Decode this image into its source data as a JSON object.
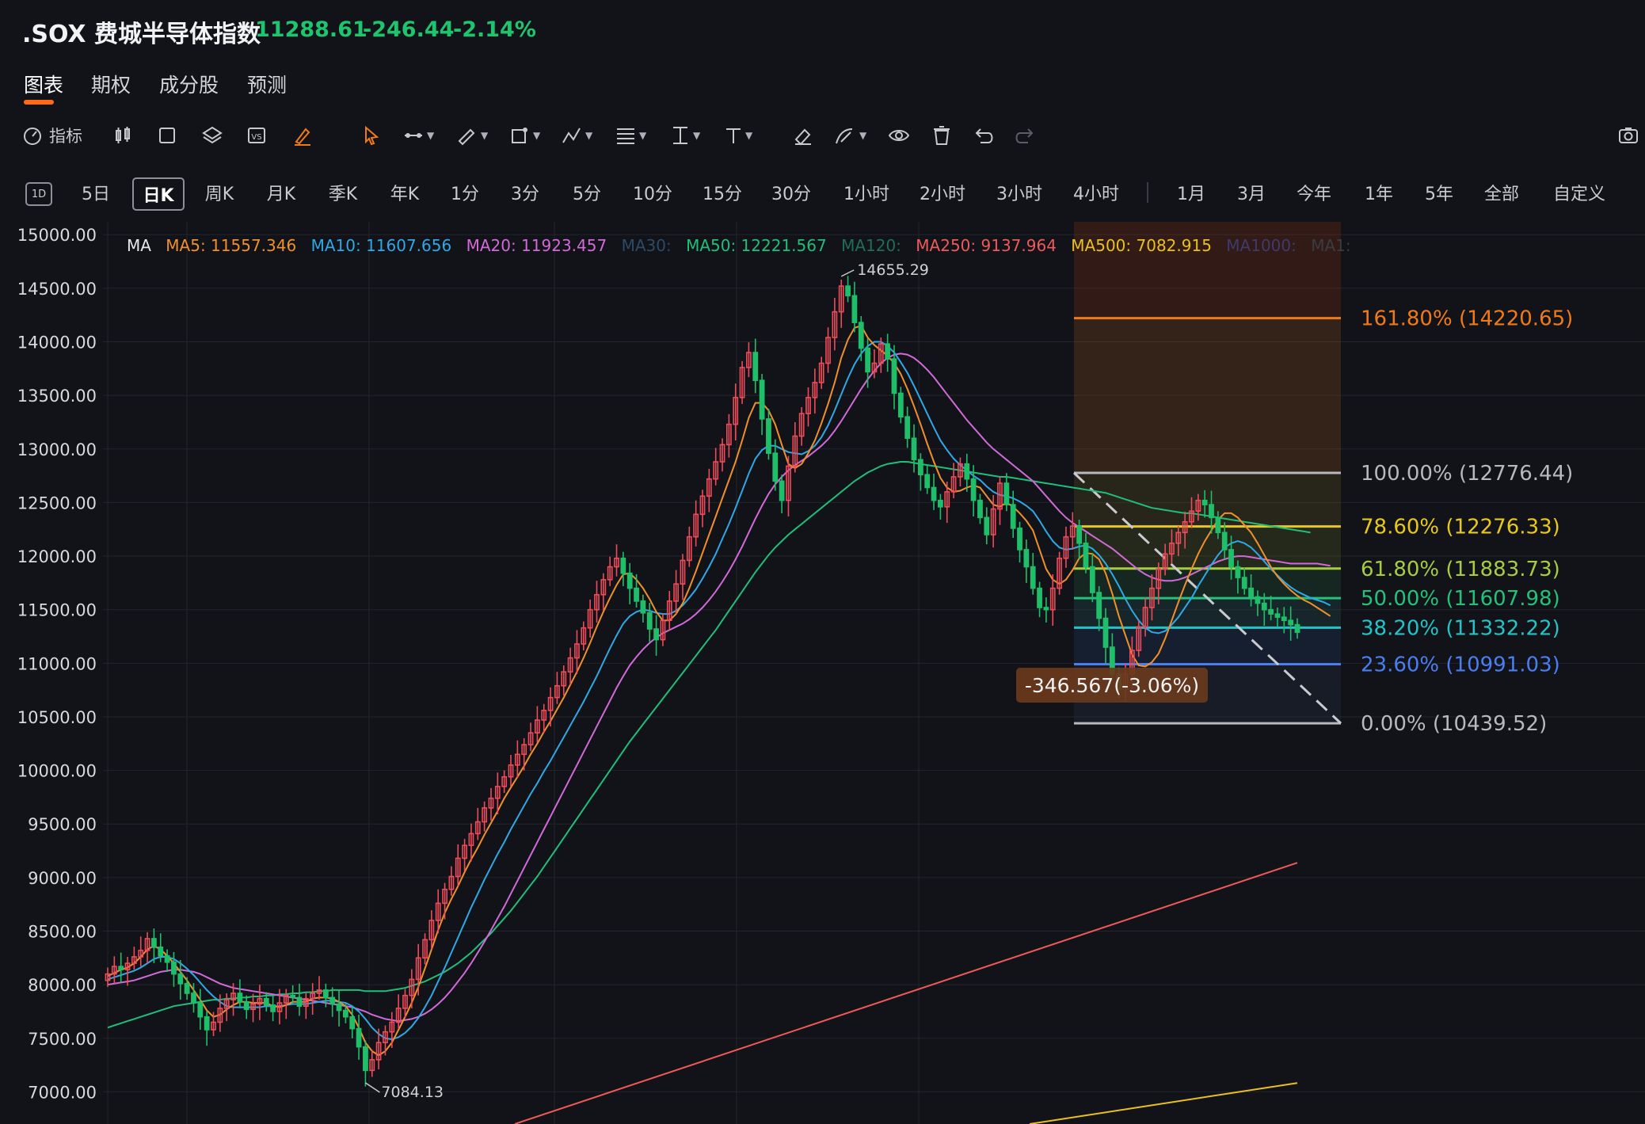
{
  "header": {
    "symbol": ".SOX 费城半导体指数",
    "price": "11288.61",
    "change": "-246.44",
    "change_pct": "-2.14%"
  },
  "tabs": [
    "图表",
    "期权",
    "成分股",
    "预测"
  ],
  "toolbar": {
    "indicator_label": "指标",
    "tools": [
      "candle-style-icon",
      "rectangle-icon",
      "layers-icon",
      "compare-icon",
      "brush-icon",
      "cursor-icon",
      "line-icon",
      "pen-icon",
      "shape-icon",
      "pattern-icon",
      "fibonacci-icon",
      "measure-icon",
      "text-icon",
      "eraser-icon",
      "draw-icon",
      "eye-icon",
      "trash-icon",
      "undo-icon",
      "redo-icon",
      "screenshot-icon"
    ]
  },
  "periods": {
    "day_badge": "1D",
    "items": [
      "5日",
      "日K",
      "周K",
      "月K",
      "季K",
      "年K",
      "1分",
      "3分",
      "5分",
      "10分",
      "15分",
      "30分",
      "1小时",
      "2小时",
      "3小时",
      "4小时",
      "1月",
      "3月",
      "今年",
      "1年",
      "5年",
      "全部",
      "自定义"
    ],
    "active": "日K"
  },
  "ma_legend": {
    "label": "MA",
    "items": [
      {
        "text": "MA5: 11557.346",
        "color": "#f0902a"
      },
      {
        "text": "MA10: 11607.656",
        "color": "#2ea8e6"
      },
      {
        "text": "MA20: 11923.457",
        "color": "#d16ad8"
      },
      {
        "text": "MA30:",
        "color": "#2c4a66"
      },
      {
        "text": "MA50: 12221.567",
        "color": "#1fbf7a"
      },
      {
        "text": "MA120:",
        "color": "#1f6e5a"
      },
      {
        "text": "MA250: 9137.964",
        "color": "#ee5a5a"
      },
      {
        "text": "MA500: 7082.915",
        "color": "#e8c020"
      },
      {
        "text": "MA1000:",
        "color": "#3e3a6a"
      },
      {
        "text": "MA1:",
        "color": "#3a3c44"
      }
    ]
  },
  "chart_data": {
    "type": "candlestick",
    "y_ticks": [
      "15000.00",
      "14500.00",
      "14000.00",
      "13500.00",
      "13000.00",
      "12500.00",
      "12000.00",
      "11500.00",
      "11000.00",
      "10500.00",
      "10000.00",
      "9500.00",
      "9000.00",
      "8500.00",
      "8000.00",
      "7500.00",
      "7000.00"
    ],
    "ylim": [
      6700,
      15120
    ],
    "high_label": "14655.29",
    "high_value": 14655.29,
    "low_label": "7084.13",
    "low_value": 7084.13,
    "measure_label": "-346.567(-3.06%)",
    "colors": {
      "up": "#ef4b5a",
      "down": "#1fbf6a",
      "grid": "#23252c"
    },
    "fibonacci": [
      {
        "label": "161.80% (14220.65)",
        "value": 14220.65,
        "color": "#f07a1a"
      },
      {
        "label": "100.00% (12776.44)",
        "value": 12776.44,
        "color": "#b7b9be"
      },
      {
        "label": "78.60% (12276.33)",
        "value": 12276.33,
        "color": "#e8c81a"
      },
      {
        "label": "61.80% (11883.73)",
        "value": 11883.73,
        "color": "#a6cc45"
      },
      {
        "label": "50.00% (11607.98)",
        "value": 11607.98,
        "color": "#22c27a"
      },
      {
        "label": "38.20% (11332.22)",
        "value": 11332.22,
        "color": "#22c4c8"
      },
      {
        "label": "23.60% (10991.03)",
        "value": 10991.03,
        "color": "#4a7ef0"
      },
      {
        "label": "0.00% (10439.52)",
        "value": 10439.52,
        "color": "#b7b9be"
      }
    ],
    "close": [
      8100,
      8170,
      8140,
      8200,
      8260,
      8320,
      8430,
      8350,
      8270,
      8210,
      8100,
      8010,
      7920,
      7830,
      7700,
      7580,
      7650,
      7780,
      7860,
      7920,
      7840,
      7770,
      7820,
      7870,
      7810,
      7750,
      7830,
      7900,
      7880,
      7800,
      7870,
      7920,
      7950,
      7880,
      7820,
      7760,
      7700,
      7590,
      7420,
      7200,
      7300,
      7460,
      7560,
      7650,
      7780,
      7900,
      8050,
      8250,
      8420,
      8600,
      8760,
      8890,
      9010,
      9180,
      9300,
      9410,
      9520,
      9650,
      9740,
      9850,
      9940,
      10050,
      10150,
      10240,
      10350,
      10470,
      10560,
      10680,
      10790,
      10920,
      11050,
      11180,
      11330,
      11500,
      11640,
      11780,
      11900,
      11980,
      11840,
      11700,
      11580,
      11470,
      11320,
      11220,
      11400,
      11580,
      11740,
      11960,
      12180,
      12390,
      12560,
      12720,
      12880,
      13040,
      13230,
      13480,
      13760,
      13900,
      13640,
      13280,
      12960,
      12700,
      12520,
      12840,
      13120,
      13330,
      13480,
      13620,
      13800,
      14040,
      14280,
      14520,
      14430,
      14180,
      13940,
      13720,
      13800,
      13980,
      13840,
      13520,
      13300,
      13100,
      12900,
      12760,
      12640,
      12520,
      12460,
      12600,
      12740,
      12860,
      12720,
      12520,
      12360,
      12200,
      12440,
      12680,
      12480,
      12260,
      12060,
      11900,
      11700,
      11520,
      11500,
      11700,
      11980,
      12180,
      12280,
      12120,
      11900,
      11660,
      11420,
      11150,
      10900,
      10760,
      10900,
      11120,
      11340,
      11520,
      11700,
      11880,
      12020,
      12120,
      12220,
      12320,
      12420,
      12520,
      12480,
      12360,
      12220,
      12060,
      11900,
      11800,
      11700,
      11620,
      11560,
      11500,
      11460,
      11430,
      11400,
      11360,
      11289
    ],
    "ma5": [
      8080,
      8110,
      8140,
      8160,
      8200,
      8260,
      8330,
      8360,
      8330,
      8270,
      8200,
      8120,
      8040,
      7950,
      7860,
      7760,
      7700,
      7720,
      7770,
      7810,
      7840,
      7840,
      7830,
      7830,
      7830,
      7800,
      7790,
      7810,
      7840,
      7840,
      7840,
      7870,
      7880,
      7880,
      7870,
      7840,
      7800,
      7720,
      7600,
      7460,
      7380,
      7340,
      7380,
      7460,
      7580,
      7700,
      7830,
      7980,
      8150,
      8330,
      8510,
      8670,
      8800,
      8920,
      9050,
      9170,
      9280,
      9400,
      9510,
      9620,
      9740,
      9840,
      9940,
      10040,
      10150,
      10250,
      10360,
      10460,
      10570,
      10680,
      10800,
      10920,
      11050,
      11190,
      11340,
      11480,
      11610,
      11730,
      11830,
      11840,
      11780,
      11700,
      11600,
      11480,
      11400,
      11400,
      11460,
      11560,
      11700,
      11860,
      12030,
      12200,
      12370,
      12540,
      12710,
      12880,
      13080,
      13290,
      13430,
      13430,
      13360,
      13230,
      13040,
      12860,
      12820,
      12860,
      12960,
      13080,
      13240,
      13420,
      13620,
      13850,
      14020,
      14130,
      14150,
      14040,
      13970,
      13920,
      13870,
      13800,
      13700,
      13560,
      13400,
      13230,
      13050,
      12880,
      12730,
      12640,
      12600,
      12610,
      12640,
      12660,
      12640,
      12560,
      12480,
      12460,
      12500,
      12460,
      12400,
      12330,
      12240,
      12060,
      11880,
      11780,
      11740,
      11780,
      11870,
      11980,
      12030,
      12020,
      11970,
      11840,
      11650,
      11440,
      11260,
      11080,
      10980,
      10970,
      11010,
      11090,
      11230,
      11400,
      11570,
      11730,
      11880,
      12020,
      12140,
      12240,
      12340,
      12400,
      12400,
      12360,
      12290,
      12220,
      12120,
      12010,
      11900,
      11810,
      11740,
      11680,
      11630,
      11590,
      11560,
      11520,
      11480,
      11440
    ],
    "ma10": [
      8050,
      8070,
      8090,
      8110,
      8130,
      8160,
      8200,
      8240,
      8260,
      8260,
      8240,
      8200,
      8150,
      8090,
      8020,
      7950,
      7890,
      7840,
      7800,
      7790,
      7790,
      7790,
      7790,
      7790,
      7800,
      7800,
      7800,
      7810,
      7820,
      7820,
      7820,
      7830,
      7840,
      7850,
      7850,
      7840,
      7830,
      7800,
      7750,
      7680,
      7600,
      7540,
      7500,
      7490,
      7510,
      7550,
      7610,
      7690,
      7790,
      7900,
      8030,
      8160,
      8300,
      8440,
      8580,
      8720,
      8850,
      8980,
      9100,
      9220,
      9330,
      9450,
      9560,
      9670,
      9780,
      9880,
      9990,
      10090,
      10200,
      10310,
      10420,
      10530,
      10640,
      10760,
      10880,
      11010,
      11140,
      11260,
      11370,
      11440,
      11480,
      11500,
      11490,
      11470,
      11460,
      11460,
      11490,
      11540,
      11610,
      11690,
      11790,
      11900,
      12020,
      12160,
      12300,
      12450,
      12610,
      12770,
      12910,
      12990,
      13030,
      13030,
      13000,
      12970,
      12960,
      12950,
      12980,
      13030,
      13110,
      13220,
      13360,
      13510,
      13660,
      13790,
      13890,
      13960,
      14000,
      14000,
      13960,
      13900,
      13810,
      13710,
      13590,
      13460,
      13330,
      13200,
      13080,
      12990,
      12910,
      12850,
      12800,
      12750,
      12710,
      12650,
      12600,
      12570,
      12560,
      12540,
      12510,
      12470,
      12420,
      12330,
      12230,
      12140,
      12080,
      12060,
      12070,
      12090,
      12100,
      12070,
      12010,
      11930,
      11830,
      11720,
      11600,
      11490,
      11400,
      11330,
      11290,
      11280,
      11300,
      11360,
      11430,
      11520,
      11610,
      11720,
      11820,
      11920,
      12010,
      12080,
      12120,
      12140,
      12120,
      12080,
      12020,
      11950,
      11880,
      11820,
      11760,
      11710,
      11670,
      11640,
      11610,
      11590,
      11570,
      11540
    ],
    "ma20": [
      8000,
      8010,
      8020,
      8030,
      8040,
      8060,
      8080,
      8100,
      8120,
      8130,
      8140,
      8140,
      8130,
      8120,
      8100,
      8070,
      8040,
      8010,
      7990,
      7970,
      7960,
      7950,
      7940,
      7930,
      7920,
      7910,
      7900,
      7890,
      7880,
      7870,
      7860,
      7850,
      7840,
      7830,
      7820,
      7810,
      7800,
      7790,
      7770,
      7750,
      7720,
      7700,
      7680,
      7670,
      7660,
      7670,
      7680,
      7700,
      7730,
      7770,
      7820,
      7880,
      7950,
      8030,
      8110,
      8200,
      8300,
      8400,
      8510,
      8620,
      8730,
      8850,
      8970,
      9090,
      9210,
      9330,
      9450,
      9570,
      9690,
      9810,
      9930,
      10050,
      10170,
      10290,
      10410,
      10530,
      10650,
      10770,
      10880,
      10980,
      11060,
      11130,
      11190,
      11240,
      11280,
      11310,
      11340,
      11370,
      11410,
      11460,
      11520,
      11590,
      11670,
      11760,
      11860,
      11970,
      12090,
      12220,
      12350,
      12470,
      12580,
      12670,
      12740,
      12800,
      12850,
      12890,
      12930,
      12980,
      13030,
      13090,
      13170,
      13260,
      13360,
      13460,
      13560,
      13650,
      13730,
      13800,
      13850,
      13880,
      13890,
      13880,
      13850,
      13800,
      13740,
      13670,
      13590,
      13510,
      13430,
      13350,
      13270,
      13200,
      13130,
      13060,
      13000,
      12950,
      12900,
      12850,
      12800,
      12750,
      12700,
      12630,
      12560,
      12490,
      12420,
      12360,
      12310,
      12270,
      12230,
      12190,
      12150,
      12110,
      12070,
      12020,
      11970,
      11920,
      11870,
      11830,
      11800,
      11780,
      11770,
      11770,
      11780,
      11800,
      11830,
      11860,
      11890,
      11920,
      11950,
      11970,
      11990,
      12000,
      12000,
      11990,
      11980,
      11970,
      11960,
      11950,
      11940,
      11930,
      11930,
      11930,
      11930,
      11930,
      11920,
      11910
    ],
    "ma50": [
      7600,
      7620,
      7640,
      7660,
      7680,
      7700,
      7720,
      7740,
      7760,
      7780,
      7800,
      7810,
      7820,
      7830,
      7840,
      7850,
      7860,
      7860,
      7870,
      7870,
      7880,
      7880,
      7890,
      7890,
      7900,
      7900,
      7910,
      7910,
      7920,
      7920,
      7930,
      7930,
      7940,
      7940,
      7950,
      7950,
      7950,
      7950,
      7950,
      7940,
      7940,
      7940,
      7940,
      7950,
      7960,
      7970,
      7990,
      8010,
      8030,
      8060,
      8090,
      8120,
      8160,
      8200,
      8250,
      8300,
      8360,
      8420,
      8480,
      8550,
      8620,
      8690,
      8770,
      8850,
      8930,
      9010,
      9100,
      9190,
      9280,
      9370,
      9460,
      9550,
      9640,
      9730,
      9820,
      9910,
      10000,
      10090,
      10180,
      10270,
      10350,
      10430,
      10510,
      10590,
      10670,
      10750,
      10830,
      10910,
      10990,
      11070,
      11150,
      11230,
      11310,
      11400,
      11490,
      11580,
      11670,
      11760,
      11850,
      11930,
      12010,
      12080,
      12140,
      12200,
      12250,
      12300,
      12350,
      12400,
      12450,
      12500,
      12550,
      12600,
      12650,
      12700,
      12740,
      12780,
      12810,
      12840,
      12860,
      12870,
      12880,
      12880,
      12870,
      12860,
      12850,
      12840,
      12830,
      12820,
      12810,
      12800,
      12790,
      12780,
      12770,
      12760,
      12750,
      12740,
      12740,
      12730,
      12720,
      12710,
      12700,
      12690,
      12680,
      12670,
      12660,
      12650,
      12640,
      12630,
      12620,
      12610,
      12600,
      12590,
      12570,
      12550,
      12530,
      12510,
      12490,
      12470,
      12450,
      12440,
      12430,
      12420,
      12410,
      12400,
      12400,
      12390,
      12380,
      12370,
      12360,
      12350,
      12340,
      12330,
      12320,
      12310,
      12300,
      12290,
      12280,
      12270,
      12260,
      12250,
      12240,
      12230,
      12220
    ]
  }
}
